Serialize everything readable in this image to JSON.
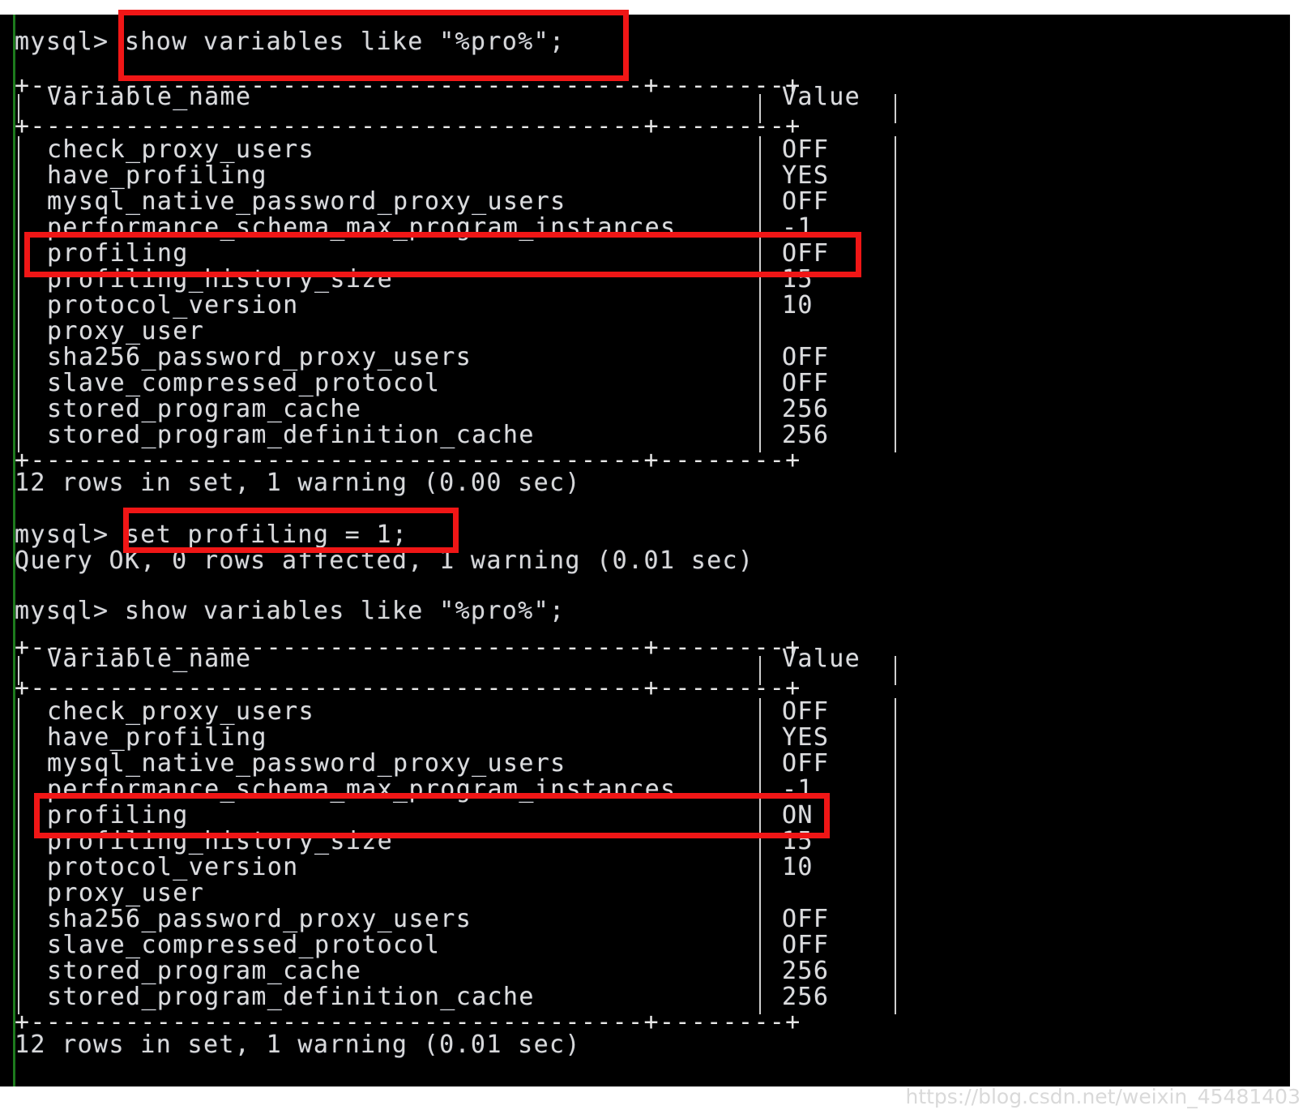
{
  "terminal": {
    "prompt": "mysql>",
    "background_color": "#000000",
    "text_color": "#d8d8d8",
    "highlight_color": "#f01616",
    "rail_color": "#1d7a1d"
  },
  "session": {
    "block1": {
      "command": "show variables like \"%pro%\";",
      "command_full": "mysql> show variables like \"%pro%\";",
      "rule_top": "+---------------------------------------+--------+",
      "rule_mid": "+---------------------------------------+--------+",
      "rule_bottom": "+---------------------------------------+--------+",
      "headers": {
        "name": "Variable_name",
        "value": "Value"
      },
      "rows": [
        {
          "name": "check_proxy_users",
          "value": "OFF"
        },
        {
          "name": "have_profiling",
          "value": "YES"
        },
        {
          "name": "mysql_native_password_proxy_users",
          "value": "OFF"
        },
        {
          "name": "performance_schema_max_program_instances",
          "value": "-1"
        },
        {
          "name": "profiling",
          "value": "OFF"
        },
        {
          "name": "profiling_history_size",
          "value": "15"
        },
        {
          "name": "protocol_version",
          "value": "10"
        },
        {
          "name": "proxy_user",
          "value": ""
        },
        {
          "name": "sha256_password_proxy_users",
          "value": "OFF"
        },
        {
          "name": "slave_compressed_protocol",
          "value": "OFF"
        },
        {
          "name": "stored_program_cache",
          "value": "256"
        },
        {
          "name": "stored_program_definition_cache",
          "value": "256"
        }
      ],
      "result_summary": "12 rows in set, 1 warning (0.00 sec)"
    },
    "block2": {
      "command": "set profiling = 1;",
      "command_full": "mysql> set profiling = 1;",
      "result_summary": "Query OK, 0 rows affected, 1 warning (0.01 sec)"
    },
    "block3": {
      "command": "show variables like \"%pro%\";",
      "command_full": "mysql> show variables like \"%pro%\";",
      "rule_top": "+---------------------------------------+--------+",
      "rule_mid": "+---------------------------------------+--------+",
      "rule_bottom": "+---------------------------------------+--------+",
      "headers": {
        "name": "Variable_name",
        "value": "Value"
      },
      "rows": [
        {
          "name": "check_proxy_users",
          "value": "OFF"
        },
        {
          "name": "have_profiling",
          "value": "YES"
        },
        {
          "name": "mysql_native_password_proxy_users",
          "value": "OFF"
        },
        {
          "name": "performance_schema_max_program_instances",
          "value": "-1"
        },
        {
          "name": "profiling",
          "value": "ON"
        },
        {
          "name": "profiling_history_size",
          "value": "15"
        },
        {
          "name": "protocol_version",
          "value": "10"
        },
        {
          "name": "proxy_user",
          "value": ""
        },
        {
          "name": "sha256_password_proxy_users",
          "value": "OFF"
        },
        {
          "name": "slave_compressed_protocol",
          "value": "OFF"
        },
        {
          "name": "stored_program_cache",
          "value": "256"
        },
        {
          "name": "stored_program_definition_cache",
          "value": "256"
        }
      ],
      "result_summary": "12 rows in set, 1 warning (0.01 sec)"
    }
  },
  "annotations": [
    {
      "id": "cmd1",
      "label": "show variables like \"%pro%\";"
    },
    {
      "id": "profiling-off",
      "label": "profiling OFF"
    },
    {
      "id": "cmd2",
      "label": "set profiling = 1;"
    },
    {
      "id": "profiling-on",
      "label": "profiling ON"
    }
  ],
  "watermark": {
    "text": "https://blog.csdn.net/weixin_45481403"
  }
}
